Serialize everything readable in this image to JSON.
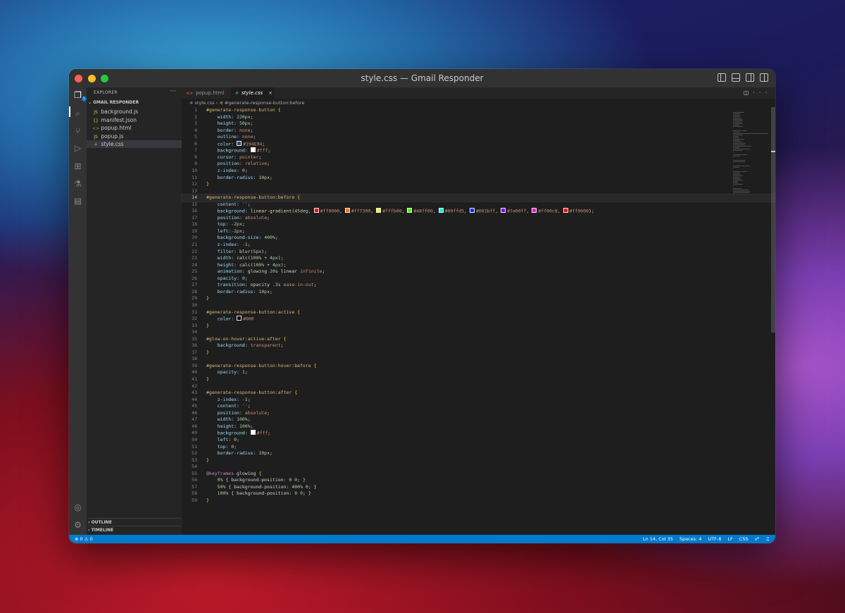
{
  "window": {
    "title": "style.css — Gmail Responder"
  },
  "sidebar": {
    "header": "EXPLORER",
    "more": "···",
    "project": "GMAIL RESPONDER",
    "files": [
      {
        "icon": "JS",
        "name": "background.js",
        "color": "#cbcb41"
      },
      {
        "icon": "{}",
        "name": "manifest.json",
        "color": "#cbcb41"
      },
      {
        "icon": "<>",
        "name": "popup.html",
        "color": "#e37933"
      },
      {
        "icon": "JS",
        "name": "popup.js",
        "color": "#cbcb41"
      },
      {
        "icon": "#",
        "name": "style.css",
        "color": "#519aba"
      }
    ],
    "outline": "OUTLINE",
    "timeline": "TIMELINE"
  },
  "tabs": [
    {
      "label": "popup.html",
      "icon": "<>"
    },
    {
      "label": "style.css",
      "icon": "#",
      "close": "×"
    }
  ],
  "breadcrumb": {
    "file": "style.css",
    "symbol": "#generate-response-button:before"
  },
  "status": {
    "problems": "⊗ 0 ⚠ 0",
    "position": "Ln 14, Col 35",
    "spaces": "Spaces: 4",
    "encoding": "UTF-8",
    "eol": "LF",
    "language": "CSS"
  },
  "code": [
    "#generate-response-button {",
    "    width: 220px;",
    "    height: 50px;",
    "    border: none;",
    "    outline: none;",
    "    color: {#194E94};",
    "    background: {#fff};",
    "    cursor: pointer;",
    "    position: relative;",
    "    z-index: 0;",
    "    border-radius: 10px;",
    "}",
    "",
    "#generate-response-button:before {",
    "    content: '';",
    "    background: linear-gradient(45deg, {#ff0000}, {#ff7300}, {#fffb00}, {#48ff00}, {#00ffd5}, {#002bff}, {#7a00ff}, {#ff00c8}, {#ff0000});",
    "    position: absolute;",
    "    top: -2px;",
    "    left:-2px;",
    "    background-size: 400%;",
    "    z-index: -1;",
    "    filter: blur(5px);",
    "    width: calc(100% + 4px);",
    "    height: calc(100% + 4px);",
    "    animation: glowing 20s linear infinite;",
    "    opacity: 0;",
    "    transition: opacity .3s ease-in-out;",
    "    border-radius: 10px;",
    "}",
    "",
    "#generate-response-button:active {",
    "    color: {#000}",
    "}",
    "",
    "#glow-on-hover:active:after {",
    "    background: transparent;",
    "}",
    "",
    "#generate-response-button:hover:before {",
    "    opacity: 1;",
    "}",
    "",
    "#generate-response-button:after {",
    "    z-index: -1;",
    "    content: '';",
    "    position: absolute;",
    "    width: 100%;",
    "    height: 100%;",
    "    background: {#fff};",
    "    left: 0;",
    "    top: 0;",
    "    border-radius: 10px;",
    "}",
    "",
    "@keyframes glowing {",
    "    0% { background-position: 0 0; }",
    "    50% { background-position: 400% 0; }",
    "    100% { background-position: 0 0; }",
    "}"
  ],
  "current_line": 14
}
